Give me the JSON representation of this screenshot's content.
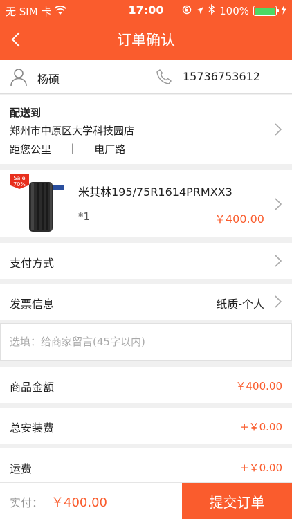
{
  "status_bar": {
    "carrier": "无 SIM 卡",
    "time": "17:00",
    "battery_percent": "100%",
    "battery_level": 1.0
  },
  "nav": {
    "title": "订单确认"
  },
  "contact": {
    "name": "杨硕",
    "phone": "15736753612"
  },
  "address": {
    "label": "配送到",
    "store": "郑州市中原区大学科技园店",
    "distance_prefix": "距您公里",
    "separator": "|",
    "road": "电厂路"
  },
  "product": {
    "sale_badge": "Sale",
    "sale_discount": "70%",
    "title": "米其林195/75R1614PRMXX3",
    "quantity": "*1",
    "price": "￥400.00"
  },
  "payment": {
    "label": "支付方式"
  },
  "invoice": {
    "label": "发票信息",
    "value": "纸质-个人"
  },
  "message": {
    "placeholder": "选填：给商家留言(45字以内)"
  },
  "fees": {
    "goods_label": "商品金额",
    "goods_amount": "￥400.00",
    "install_label": "总安装费",
    "install_amount": "+￥0.00",
    "shipping_label": "运费",
    "shipping_amount": "+￥0.00"
  },
  "footer": {
    "paid_label": "实付：",
    "paid_amount": "￥400.00",
    "submit_label": "提交订单"
  },
  "colors": {
    "accent": "#fa5c2d",
    "battery": "#4cd964"
  }
}
